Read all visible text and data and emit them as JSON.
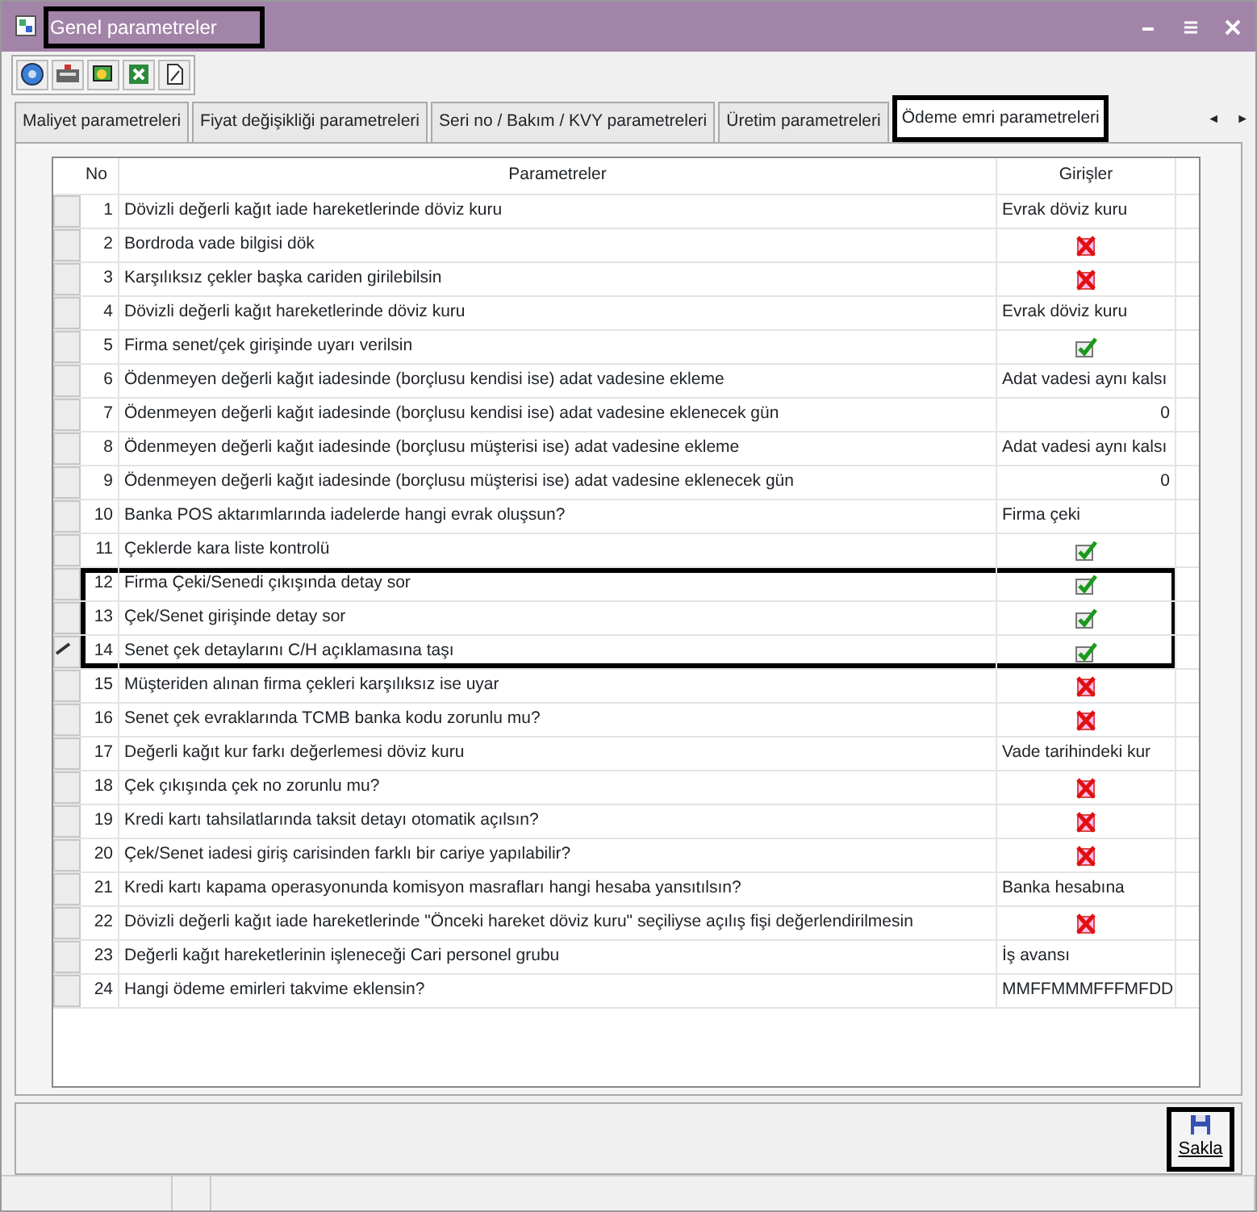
{
  "window": {
    "title": "Genel parametreler",
    "highlighted": true
  },
  "tabs": [
    {
      "label": "Maliyet parametreleri",
      "selected": false,
      "highlighted": false
    },
    {
      "label": "Fiyat değişikliği parametreleri",
      "selected": false,
      "highlighted": false
    },
    {
      "label": "Seri no / Bakım / KVY parametreleri",
      "selected": false,
      "highlighted": false
    },
    {
      "label": "Üretim parametreleri",
      "selected": false,
      "highlighted": false
    },
    {
      "label": "Ödeme emri parametreleri",
      "selected": true,
      "highlighted": true
    }
  ],
  "tab_scroll": [
    "◄",
    "►"
  ],
  "table": {
    "columns": [
      "No",
      "Parametreler",
      "Girişler"
    ],
    "rows": [
      {
        "no": "1",
        "param": "Dövizli değerli kağıt iade hareketlerinde döviz kuru",
        "kind": "text",
        "value": "Evrak döviz kuru",
        "selected": false,
        "highlighted": false
      },
      {
        "no": "2",
        "param": "Bordroda vade bilgisi dök",
        "kind": "check",
        "checked": false,
        "selected": false,
        "highlighted": false
      },
      {
        "no": "3",
        "param": "Karşılıksız çekler başka cariden girilebilsin",
        "kind": "check",
        "checked": false,
        "selected": false,
        "highlighted": false
      },
      {
        "no": "4",
        "param": "Dövizli değerli kağıt hareketlerinde döviz kuru",
        "kind": "text",
        "value": "Evrak döviz kuru",
        "selected": false,
        "highlighted": false
      },
      {
        "no": "5",
        "param": "Firma senet/çek girişinde uyarı verilsin",
        "kind": "check",
        "checked": true,
        "selected": false,
        "highlighted": false
      },
      {
        "no": "6",
        "param": "Ödenmeyen değerli kağıt iadesinde (borçlusu kendisi ise) adat vadesine ekleme",
        "kind": "text",
        "value": "Adat vadesi aynı kalsı",
        "selected": false,
        "highlighted": false
      },
      {
        "no": "7",
        "param": "Ödenmeyen değerli kağıt iadesinde (borçlusu kendisi ise) adat vadesine eklenecek gün",
        "kind": "number",
        "value": "0",
        "selected": false,
        "highlighted": false
      },
      {
        "no": "8",
        "param": "Ödenmeyen değerli kağıt iadesinde (borçlusu müşterisi ise) adat vadesine ekleme",
        "kind": "text",
        "value": "Adat vadesi aynı kalsı",
        "selected": false,
        "highlighted": false
      },
      {
        "no": "9",
        "param": "Ödenmeyen değerli kağıt iadesinde (borçlusu müşterisi ise) adat vadesine eklenecek gün",
        "kind": "number",
        "value": "0",
        "selected": false,
        "highlighted": false
      },
      {
        "no": "10",
        "param": "Banka POS aktarımlarında iadelerde hangi evrak oluşsun?",
        "kind": "text",
        "value": "Firma çeki",
        "selected": false,
        "highlighted": false
      },
      {
        "no": "11",
        "param": "Çeklerde kara liste kontrolü",
        "kind": "check",
        "checked": true,
        "selected": false,
        "highlighted": false
      },
      {
        "no": "12",
        "param": "Firma Çeki/Senedi çıkışında detay sor",
        "kind": "check",
        "checked": true,
        "selected": false,
        "highlighted": true
      },
      {
        "no": "13",
        "param": "Çek/Senet girişinde detay sor",
        "kind": "check",
        "checked": true,
        "selected": false,
        "highlighted": true
      },
      {
        "no": "14",
        "param": "Senet çek detaylarını C/H açıklamasına taşı",
        "kind": "check",
        "checked": true,
        "selected": true,
        "highlighted": true
      },
      {
        "no": "15",
        "param": "Müşteriden alınan firma çekleri karşılıksız ise uyar",
        "kind": "check",
        "checked": false,
        "selected": false,
        "highlighted": false
      },
      {
        "no": "16",
        "param": "Senet çek evraklarında TCMB banka kodu zorunlu mu?",
        "kind": "check",
        "checked": false,
        "selected": false,
        "highlighted": false
      },
      {
        "no": "17",
        "param": "Değerli kağıt kur farkı değerlemesi döviz kuru",
        "kind": "text",
        "value": "Vade tarihindeki kur",
        "selected": false,
        "highlighted": false
      },
      {
        "no": "18",
        "param": "Çek çıkışında çek no zorunlu mu?",
        "kind": "check",
        "checked": false,
        "selected": false,
        "highlighted": false
      },
      {
        "no": "19",
        "param": "Kredi kartı tahsilatlarında taksit detayı otomatik açılsın?",
        "kind": "check",
        "checked": false,
        "selected": false,
        "highlighted": false
      },
      {
        "no": "20",
        "param": "Çek/Senet iadesi giriş carisinden farklı bir cariye yapılabilir?",
        "kind": "check",
        "checked": false,
        "selected": false,
        "highlighted": false
      },
      {
        "no": "21",
        "param": "Kredi kartı kapama operasyonunda komisyon masrafları hangi hesaba yansıtılsın?",
        "kind": "text",
        "value": "Banka hesabına",
        "selected": false,
        "highlighted": false
      },
      {
        "no": "22",
        "param": "Dövizli değerli kağıt iade hareketlerinde \"Önceki hareket döviz kuru\" seçiliyse açılış fişi değerlendirilmesin",
        "kind": "check",
        "checked": false,
        "selected": false,
        "highlighted": false
      },
      {
        "no": "23",
        "param": "Değerli kağıt hareketlerinin işleneceği Cari personel grubu",
        "kind": "text",
        "value": "İş avansı",
        "selected": false,
        "highlighted": false
      },
      {
        "no": "24",
        "param": "Hangi ödeme emirleri takvime eklensin?",
        "kind": "text",
        "value": "MMFFMMMFFFMFDD",
        "selected": false,
        "highlighted": false
      }
    ]
  },
  "save_button": {
    "label": "Sakla",
    "highlighted": true
  }
}
